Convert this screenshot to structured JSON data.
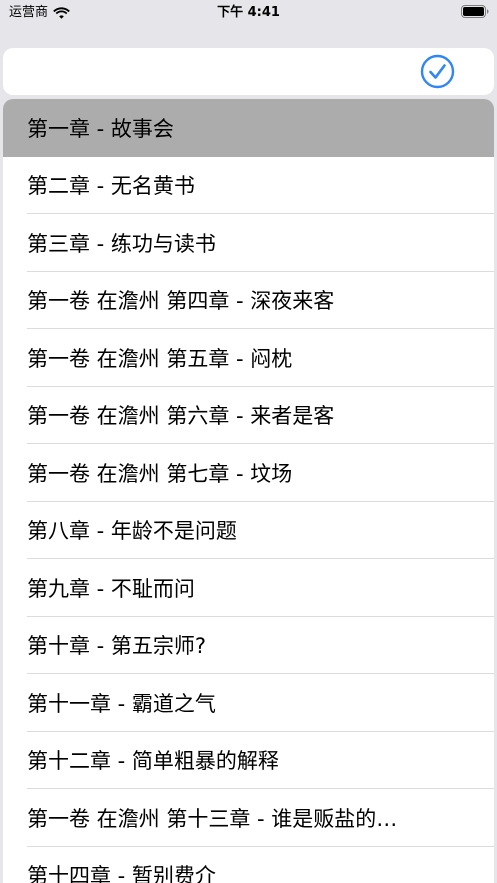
{
  "status_bar": {
    "carrier": "运营商",
    "time": "下午 4:41",
    "icons": [
      "wifi-icon",
      "battery-icon"
    ]
  },
  "top_bar": {
    "confirm_icon": "checkmark-circle-icon",
    "accent_color": "#2f86f5"
  },
  "chapters": [
    {
      "label": "第一章 - 故事会",
      "selected": true
    },
    {
      "label": "第二章 - 无名黄书"
    },
    {
      "label": "第三章 - 练功与读书"
    },
    {
      "label": "第一卷 在澹州 第四章 - 深夜来客"
    },
    {
      "label": "第一卷 在澹州 第五章 - 闷枕"
    },
    {
      "label": "第一卷 在澹州 第六章 - 来者是客"
    },
    {
      "label": "第一卷 在澹州 第七章 - 坟场"
    },
    {
      "label": "第八章 - 年龄不是问题"
    },
    {
      "label": "第九章 - 不耻而问"
    },
    {
      "label": "第十章 - 第五宗师?"
    },
    {
      "label": "第十一章 - 霸道之气"
    },
    {
      "label": "第十二章 - 简单粗暴的解释"
    },
    {
      "label": "第一卷 在澹州 第十三章 - 谁是贩盐的…"
    },
    {
      "label": "第十四章 - 暂别费介"
    }
  ]
}
